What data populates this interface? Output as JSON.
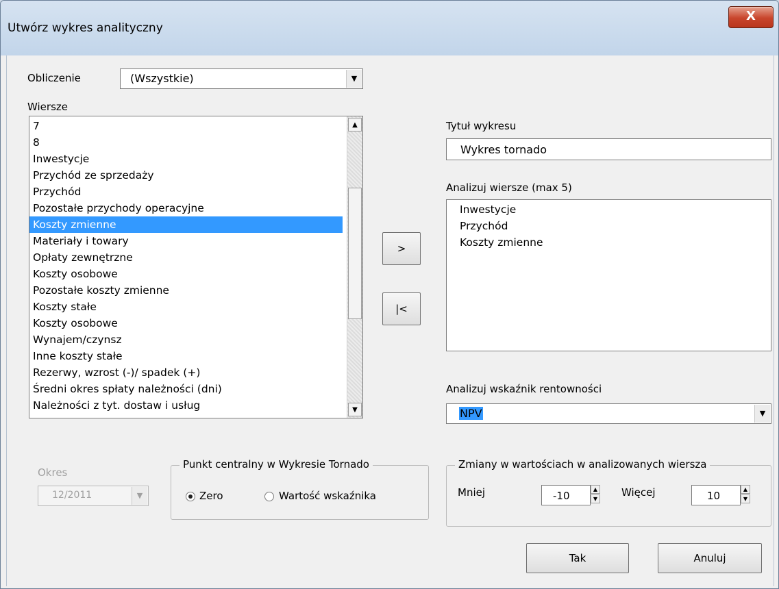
{
  "window": {
    "title": "Utwórz wykres analityczny",
    "close_label": "X"
  },
  "calc": {
    "label": "Obliczenie",
    "value": "(Wszystkie)"
  },
  "rows": {
    "label": "Wiersze",
    "items": [
      "7",
      "8",
      "Inwestycje",
      "Przychód ze sprzedaży",
      "Przychód",
      "Pozostałe przychody operacyjne",
      "Koszty zmienne",
      "Materiały i towary",
      "Opłaty zewnętrzne",
      "Koszty osobowe",
      "Pozostałe koszty zmienne",
      "Koszty stałe",
      "Koszty osobowe",
      "Wynajem/czynsz",
      "Inne koszty stałe",
      "Rezerwy, wzrost (-)/ spadek (+)",
      "Średni okres spłaty należności (dni)",
      "Należności z tyt. dostaw i usług"
    ],
    "selected": "Koszty zmienne"
  },
  "buttons": {
    "add": ">",
    "remove": "|<",
    "ok": "Tak",
    "cancel": "Anuluj"
  },
  "chart_title": {
    "label": "Tytuł wykresu",
    "value": "Wykres tornado"
  },
  "analyze_rows": {
    "label": "Analizuj wiersze (max 5)",
    "items": [
      "Inwestycje",
      "Przychód",
      "Koszty zmienne"
    ]
  },
  "indicator": {
    "label": "Analizuj wskaźnik rentowności",
    "value": "NPV"
  },
  "period": {
    "label": "Okres",
    "value": "12/2011"
  },
  "center_point": {
    "legend": "Punkt centralny w Wykresie Tornado",
    "option_zero": "Zero",
    "option_indicator": "Wartość wskaźnika",
    "selected": "Zero"
  },
  "changes": {
    "legend": "Zmiany w wartościach w analizowanych wiersza",
    "less_label": "Mniej",
    "less_value": "-10",
    "more_label": "Więcej",
    "more_value": "10"
  },
  "colors": {
    "selection": "#3399ff",
    "close_button": "#c8452c"
  }
}
